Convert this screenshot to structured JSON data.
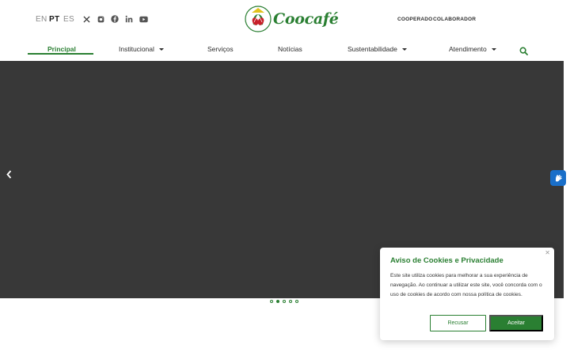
{
  "header": {
    "languages": [
      {
        "code": "EN",
        "active": false
      },
      {
        "code": "PT",
        "active": true
      },
      {
        "code": "ES",
        "active": false
      }
    ],
    "social_icons": [
      "x-icon",
      "instagram-icon",
      "facebook-icon",
      "linkedin-icon",
      "youtube-icon"
    ],
    "logo_text": "Coocafé",
    "top_links": [
      "COOPERADO",
      "COLABORADOR"
    ]
  },
  "nav": {
    "items": [
      {
        "label": "Principal",
        "active": true,
        "has_dropdown": false
      },
      {
        "label": "Institucional",
        "active": false,
        "has_dropdown": true
      },
      {
        "label": "Serviços",
        "active": false,
        "has_dropdown": false
      },
      {
        "label": "Notícias",
        "active": false,
        "has_dropdown": false
      },
      {
        "label": "Sustentabilidade",
        "active": false,
        "has_dropdown": true
      },
      {
        "label": "Atendimento",
        "active": false,
        "has_dropdown": true
      }
    ],
    "search_icon": "search-icon"
  },
  "slider": {
    "background": "#383838",
    "prev_icon": "chevron-left-icon",
    "slide_count": 5,
    "active_slide": 2
  },
  "accessibility": {
    "icon": "sign-language-icon",
    "color": "#1a6fc9"
  },
  "cookie_notice": {
    "title": "Aviso de Cookies e Privacidade",
    "text": "Este site utiliza cookies para melhorar a sua experiência de navegação. Ao continuar a utilizar este site, você concorda com o uso de cookies de acordo com nossa política de cookies.",
    "decline_label": "Recusar",
    "accept_label": "Aceitar",
    "close_icon": "close-icon"
  },
  "colors": {
    "brand": "#2a7f32",
    "text": "#2b2b2b"
  }
}
